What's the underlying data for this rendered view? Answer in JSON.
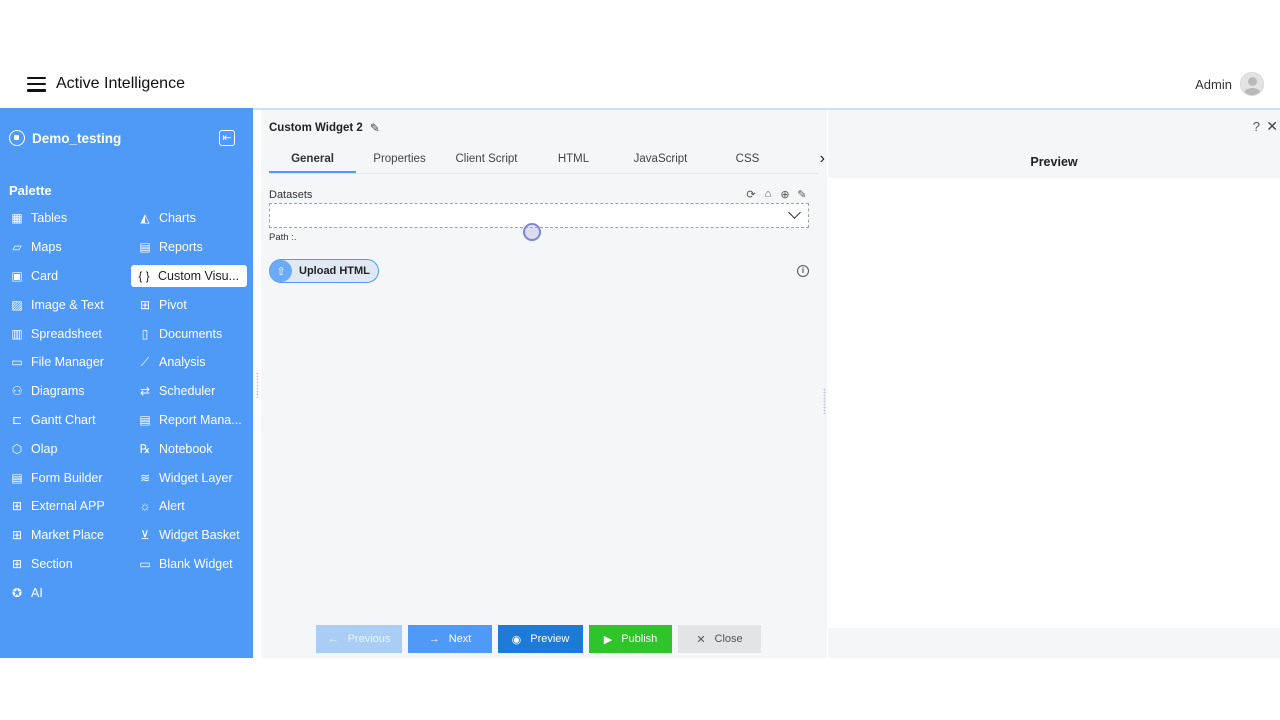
{
  "app": {
    "title": "Active Intelligence",
    "user_name": "Admin"
  },
  "sidebar": {
    "workspace": "Demo_testing",
    "palette_title": "Palette",
    "items": [
      {
        "label": "Tables",
        "icon": "table-icon",
        "glyph": "▦"
      },
      {
        "label": "Charts",
        "icon": "chart-icon",
        "glyph": "◭"
      },
      {
        "label": "Maps",
        "icon": "map-icon",
        "glyph": "▱"
      },
      {
        "label": "Reports",
        "icon": "report-icon",
        "glyph": "▤"
      },
      {
        "label": "Card",
        "icon": "card-icon",
        "glyph": "▣"
      },
      {
        "label": "Custom Visu...",
        "icon": "braces-icon",
        "glyph": "{ }"
      },
      {
        "label": "Image & Text",
        "icon": "image-icon",
        "glyph": "▨"
      },
      {
        "label": "Pivot",
        "icon": "pivot-icon",
        "glyph": "⊞"
      },
      {
        "label": "Spreadsheet",
        "icon": "spreadsheet-icon",
        "glyph": "▥"
      },
      {
        "label": "Documents",
        "icon": "document-icon",
        "glyph": "▯"
      },
      {
        "label": "File Manager",
        "icon": "file-manager-icon",
        "glyph": "▭"
      },
      {
        "label": "Analysis",
        "icon": "analysis-icon",
        "glyph": "⟋"
      },
      {
        "label": "Diagrams",
        "icon": "diagram-icon",
        "glyph": "⚇"
      },
      {
        "label": "Scheduler",
        "icon": "scheduler-icon",
        "glyph": "⇄"
      },
      {
        "label": "Gantt Chart",
        "icon": "gantt-icon",
        "glyph": "⊏"
      },
      {
        "label": "Report Mana...",
        "icon": "report-manager-icon",
        "glyph": "▤"
      },
      {
        "label": "Olap",
        "icon": "olap-icon",
        "glyph": "⬡"
      },
      {
        "label": "Notebook",
        "icon": "notebook-icon",
        "glyph": "℞"
      },
      {
        "label": "Form Builder",
        "icon": "form-builder-icon",
        "glyph": "▤"
      },
      {
        "label": "Widget Layer",
        "icon": "layers-icon",
        "glyph": "≋"
      },
      {
        "label": "External APP",
        "icon": "external-app-icon",
        "glyph": "⊞"
      },
      {
        "label": "Alert",
        "icon": "alert-icon",
        "glyph": "☼"
      },
      {
        "label": "Market Place",
        "icon": "marketplace-icon",
        "glyph": "⊞"
      },
      {
        "label": "Widget Basket",
        "icon": "basket-icon",
        "glyph": "⊻"
      },
      {
        "label": "Section",
        "icon": "section-icon",
        "glyph": "⊞"
      },
      {
        "label": "Blank Widget",
        "icon": "blank-widget-icon",
        "glyph": "▭"
      },
      {
        "label": "AI",
        "icon": "ai-icon",
        "glyph": "✪"
      }
    ]
  },
  "editor": {
    "widget_title": "Custom Widget 2",
    "tabs": [
      "General",
      "Properties",
      "Client Script",
      "HTML",
      "JavaScript",
      "CSS"
    ],
    "datasets_label": "Datasets",
    "path_label": "Path :.",
    "upload_label": "Upload HTML",
    "footer": {
      "previous": "Previous",
      "next": "Next",
      "preview": "Preview",
      "publish": "Publish",
      "close": "Close"
    }
  },
  "preview": {
    "title": "Preview"
  },
  "colors": {
    "sidebar": "#4f9af7",
    "accent": "#4f9af7",
    "preview_button": "#1d7ad6",
    "publish_button": "#2ec42a",
    "close_button": "#e2e4e6"
  }
}
